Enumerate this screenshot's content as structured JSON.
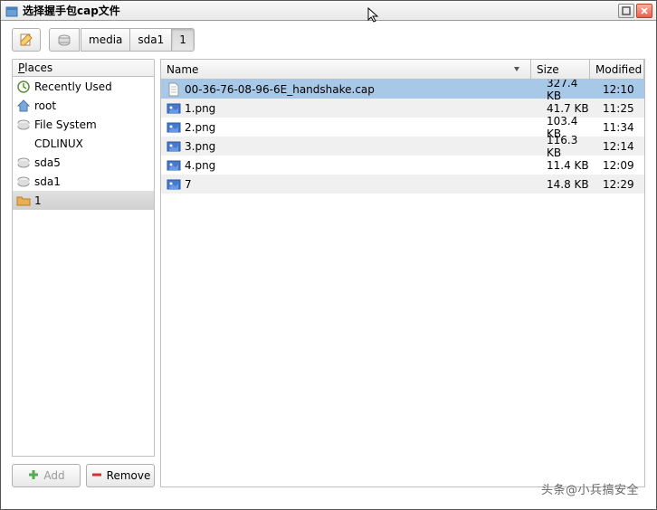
{
  "window": {
    "title": "选择握手包cap文件"
  },
  "breadcrumb": {
    "items": [
      "media",
      "sda1",
      "1"
    ],
    "active_index": 2
  },
  "places": {
    "header_prefix": "P",
    "header_rest": "laces",
    "items": [
      {
        "label": "Recently Used",
        "icon": "recent-icon",
        "selected": false
      },
      {
        "label": "root",
        "icon": "home-icon",
        "selected": false
      },
      {
        "label": "File System",
        "icon": "drive-icon",
        "selected": false
      },
      {
        "label": "CDLINUX",
        "icon": "blank-icon",
        "selected": false
      },
      {
        "label": "sda5",
        "icon": "drive-icon",
        "selected": false
      },
      {
        "label": "sda1",
        "icon": "drive-icon",
        "selected": false
      },
      {
        "label": "1",
        "icon": "folder-icon",
        "selected": true
      }
    ],
    "add_label": "Add",
    "remove_label": "Remove"
  },
  "file_list": {
    "columns": {
      "name": "Name",
      "size": "Size",
      "modified": "Modified"
    },
    "rows": [
      {
        "name": "00-36-76-08-96-6E_handshake.cap",
        "size": "327.4 KB",
        "modified": "12:10",
        "icon": "file-icon",
        "selected": true
      },
      {
        "name": "1.png",
        "size": "41.7 KB",
        "modified": "11:25",
        "icon": "image-icon",
        "selected": false
      },
      {
        "name": "2.png",
        "size": "103.4 KB",
        "modified": "11:34",
        "icon": "image-icon",
        "selected": false
      },
      {
        "name": "3.png",
        "size": "116.3 KB",
        "modified": "12:14",
        "icon": "image-icon",
        "selected": false
      },
      {
        "name": "4.png",
        "size": "11.4 KB",
        "modified": "12:09",
        "icon": "image-icon",
        "selected": false
      },
      {
        "name": "7",
        "size": "14.8 KB",
        "modified": "12:29",
        "icon": "image-icon",
        "selected": false
      }
    ]
  },
  "watermark": "头条@小兵搞安全"
}
